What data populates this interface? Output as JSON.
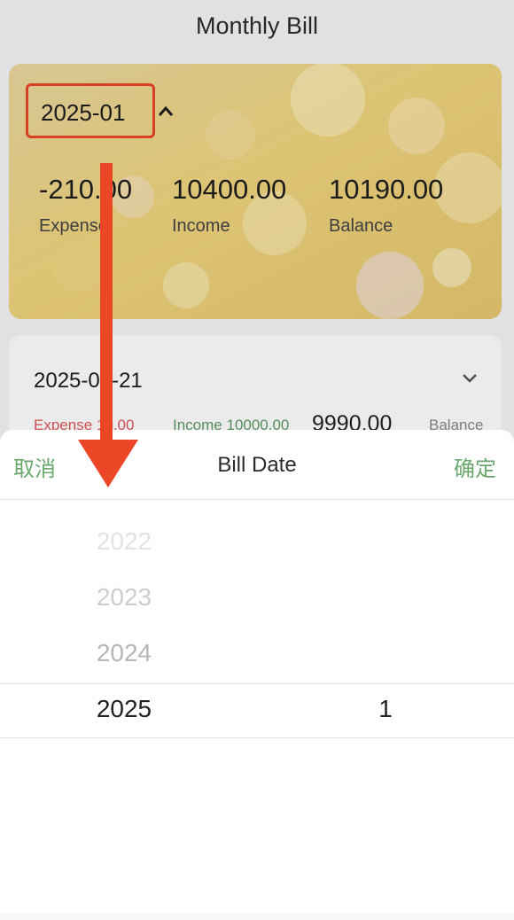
{
  "header": {
    "title": "Monthly Bill"
  },
  "summary": {
    "month": "2025-01",
    "expense_value": "-210.00",
    "expense_label": "Expense",
    "income_value": "10400.00",
    "income_label": "Income",
    "balance_value": "10190.00",
    "balance_label": "Balance"
  },
  "day_record": {
    "date": "2025-01-21",
    "expense_label": "Expense",
    "expense_value": "10.00",
    "income_label": "Income",
    "income_value": "10000.00",
    "balance_value": "9990.00",
    "balance_label": "Balance"
  },
  "picker": {
    "cancel_label": "取消",
    "title": "Bill Date",
    "confirm_label": "确定",
    "years": [
      "2022",
      "2023",
      "2024",
      "2025"
    ],
    "selected_year": "2025",
    "selected_month": "1"
  },
  "colors": {
    "accent_green": "#6aa86e",
    "highlight_red": "#eb4626",
    "expense_red": "#e0565b",
    "income_green": "#5d9b63",
    "card_gold": "#e8cf86"
  }
}
